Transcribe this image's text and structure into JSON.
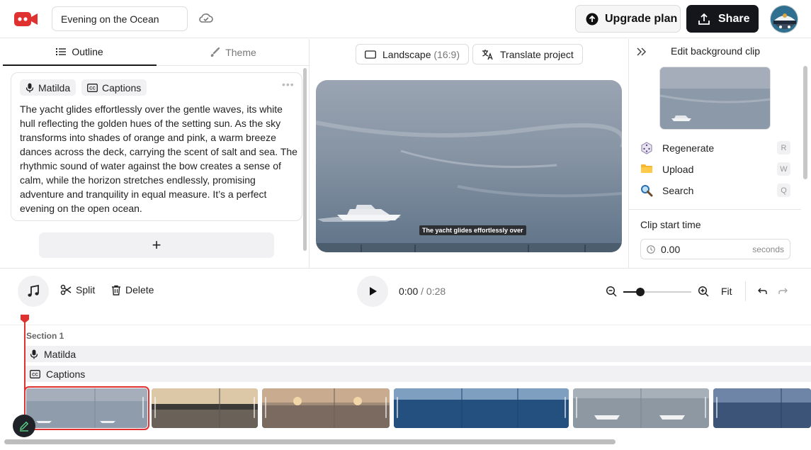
{
  "header": {
    "project_title": "Evening on the Ocean",
    "upgrade_label": "Upgrade plan",
    "share_label": "Share",
    "brand_color": "#e03131"
  },
  "left": {
    "tabs": [
      {
        "label": "Outline",
        "active": true
      },
      {
        "label": "Theme",
        "active": false
      }
    ],
    "card": {
      "voice": "Matilda",
      "captions": "Captions",
      "text": "The yacht glides effortlessly over the gentle waves, its white hull reflecting the golden hues of the setting sun. As the sky transforms into shades of orange and pink, a warm breeze dances across the deck, carrying the scent of salt and sea. The rhythmic sound of water against the bow creates a sense of calm, while the horizon stretches endlessly, promising adventure and tranquility in equal measure. It’s a perfect evening on the open ocean."
    },
    "add_label": "+"
  },
  "center": {
    "orientation_label": "Landscape",
    "orientation_ratio": "(16:9)",
    "translate_label": "Translate project",
    "caption_overlay": "The yacht glides effortlessly over"
  },
  "right": {
    "title": "Edit background clip",
    "actions": [
      {
        "label": "Regenerate",
        "shortcut": "R",
        "icon": "dice-icon"
      },
      {
        "label": "Upload",
        "shortcut": "W",
        "icon": "folder-icon"
      },
      {
        "label": "Search",
        "shortcut": "Q",
        "icon": "magnifier-icon"
      }
    ],
    "clip_start_label": "Clip start time",
    "clip_start_value": "0.00",
    "clip_start_unit": "seconds"
  },
  "toolbar": {
    "split_label": "Split",
    "delete_label": "Delete",
    "current_time": "0:00",
    "separator": "/",
    "total_time": "0:28",
    "fit_label": "Fit",
    "zoom_level": 0.25
  },
  "timeline": {
    "section_label": "Section 1",
    "voice_track": "Matilda",
    "captions_track": "Captions"
  }
}
